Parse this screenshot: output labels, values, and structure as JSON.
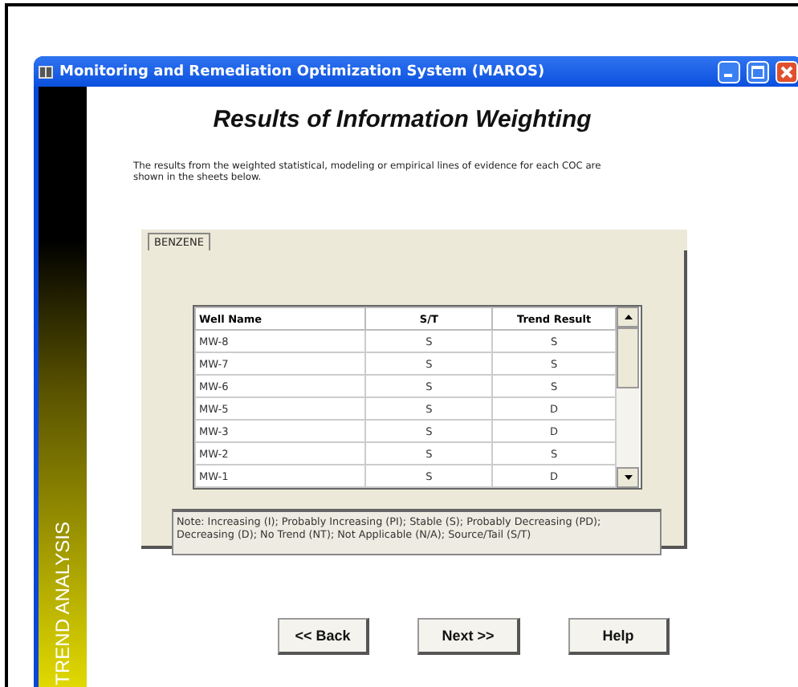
{
  "window": {
    "title": "Monitoring and Remediation Optimization System (MAROS)"
  },
  "sidebar": {
    "label": "TREND ANALYSIS"
  },
  "heading": "Results of Information Weighting",
  "description": "The results from the weighted statistical, modeling or empirical lines of evidence for each COC are shown in the sheets below.",
  "tabs": [
    {
      "label": "BENZENE",
      "selected": true
    }
  ],
  "table": {
    "columns": [
      "Well Name",
      "S/T",
      "Trend Result"
    ],
    "rows": [
      [
        "MW-8",
        "S",
        "S"
      ],
      [
        "MW-7",
        "S",
        "S"
      ],
      [
        "MW-6",
        "S",
        "S"
      ],
      [
        "MW-5",
        "S",
        "D"
      ],
      [
        "MW-3",
        "S",
        "D"
      ],
      [
        "MW-2",
        "S",
        "S"
      ],
      [
        "MW-1",
        "S",
        "D"
      ]
    ]
  },
  "note": "Note: Increasing (I); Probably Increasing (PI); Stable (S); Probably Decreasing (PD); Decreasing (D); No Trend (NT); Not Applicable (N/A); Source/Tail (S/T)",
  "buttons": [
    "<< Back",
    "Next >>",
    "Help"
  ]
}
